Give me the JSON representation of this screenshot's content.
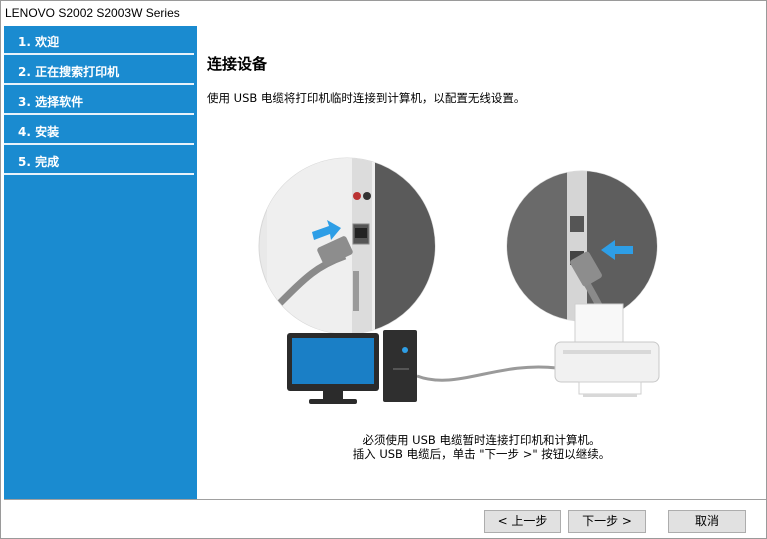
{
  "window": {
    "title": "LENOVO S2002 S2003W Series"
  },
  "sidebar": {
    "steps": [
      {
        "label": "1. 欢迎"
      },
      {
        "label": "2. 正在搜索打印机"
      },
      {
        "label": "3. 选择软件"
      },
      {
        "label": "4. 安装"
      },
      {
        "label": "5. 完成"
      }
    ]
  },
  "main": {
    "heading": "连接设备",
    "description": "使用 USB 电缆将打印机临时连接到计算机，以配置无线设置。",
    "note_line1": "必须使用 USB 电缆暂时连接打印机和计算机。",
    "note_line2": "插入 USB 电缆后，单击 \"下一步 >\" 按钮以继续。"
  },
  "buttons": {
    "back": "< 上一步",
    "next": "下一步 >",
    "cancel": "取消"
  },
  "colors": {
    "sidebar_bg": "#1a8bd0",
    "arrow": "#2e9ee6"
  }
}
